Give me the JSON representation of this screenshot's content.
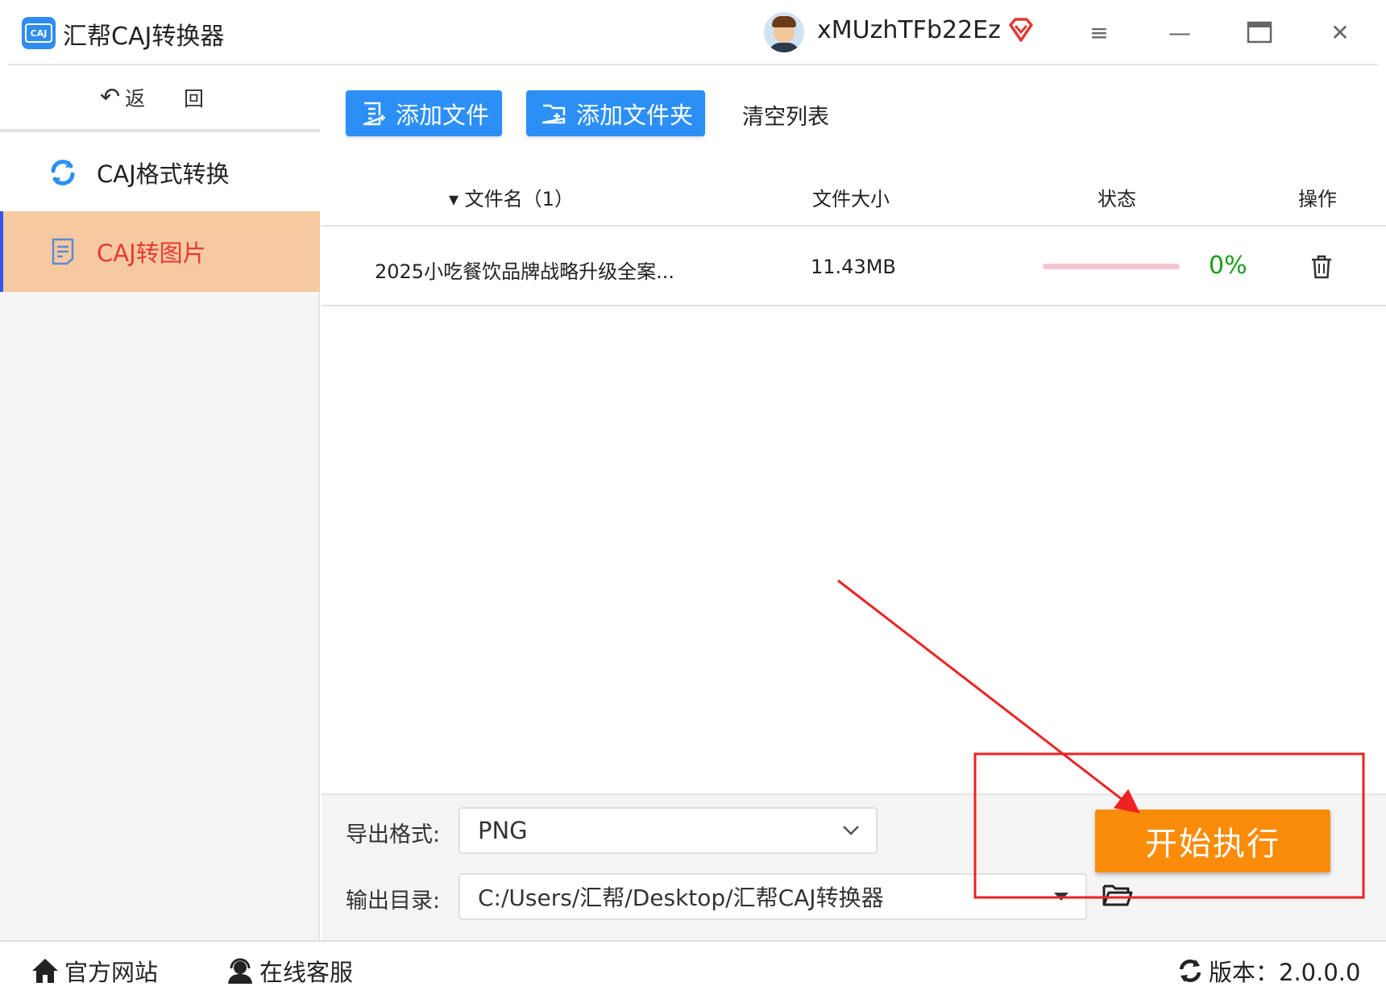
{
  "app": {
    "title": "汇帮CAJ转换器",
    "logo_text": "CAJ",
    "username": "xMUzhTFb22Ez",
    "vip_icon": "diamond-heart-icon",
    "accent_color": "#2c8ff5"
  },
  "window_controls": {
    "menu_glyph": "≡",
    "minimize_glyph": "—",
    "maximize_glyph": "▭",
    "close_glyph": "✕"
  },
  "sidebar": {
    "back_arrow": "↶",
    "back_label": "返 回",
    "items": [
      {
        "label": "CAJ格式转换",
        "icon": "refresh-icon",
        "active": false
      },
      {
        "label": "CAJ转图片",
        "icon": "document-icon",
        "active": true
      }
    ]
  },
  "toolbar": {
    "add_file": "添加文件",
    "add_folder": "添加文件夹",
    "clear_list": "清空列表"
  },
  "table": {
    "columns": {
      "name": "▾ 文件名（1）",
      "size": "文件大小",
      "status": "状态",
      "action": "操作"
    },
    "rows": [
      {
        "name": "2025小吃餐饮品牌战略升级全案...",
        "size": "11.43MB",
        "progress": 0,
        "progress_text": "0%"
      }
    ]
  },
  "bottom": {
    "format_label": "导出格式:",
    "format_value": "PNG",
    "dir_label": "输出目录:",
    "dir_value": "C:/Users/汇帮/Desktop/汇帮CAJ转换器",
    "start_button": "开始执行",
    "start_color": "#fa8c0a"
  },
  "footer": {
    "website": "官方网站",
    "support": "在线客服",
    "version": "版本：2.0.0.0"
  },
  "annotation_color": "#ee2222"
}
